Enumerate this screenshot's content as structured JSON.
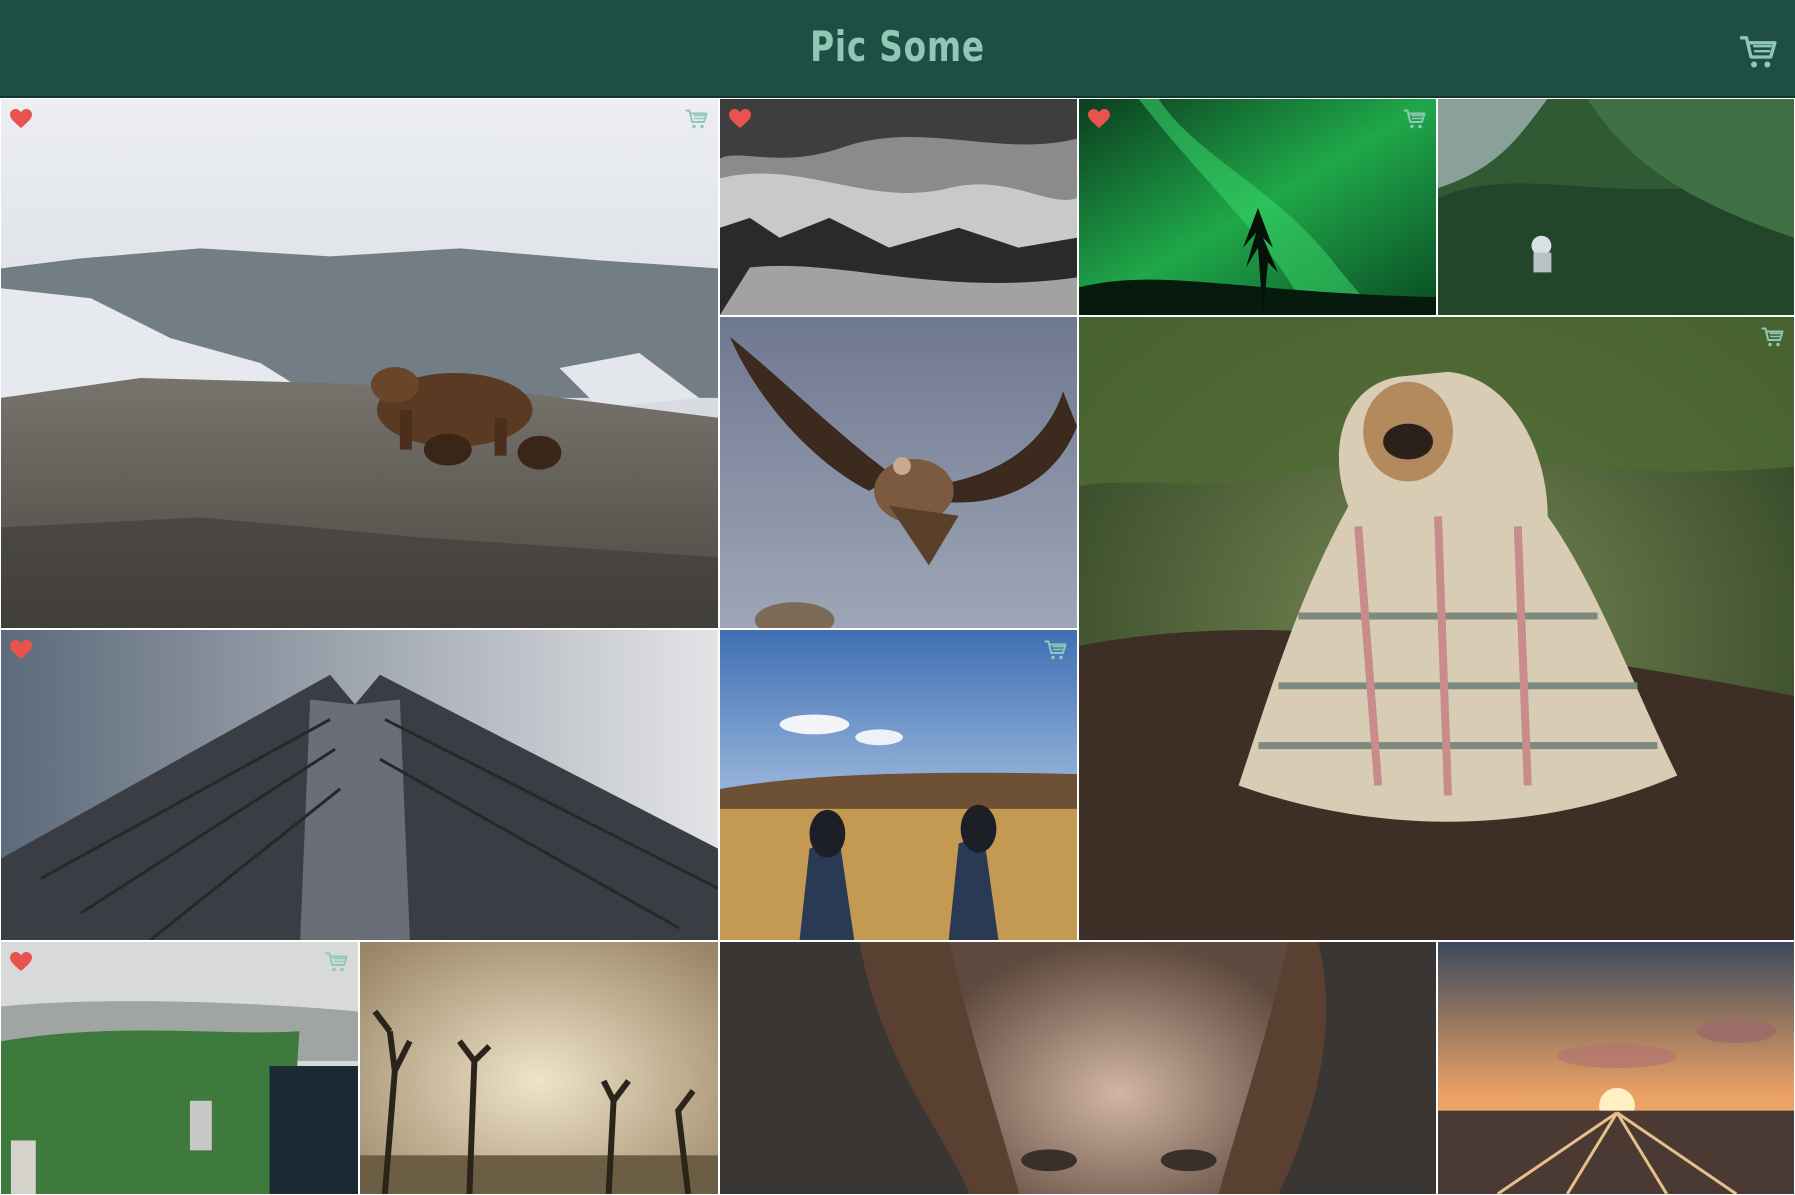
{
  "app": {
    "title": "Pic Some"
  },
  "header": {
    "cart_icon": "cart-icon"
  },
  "colors": {
    "header_bg": "#1f4e45",
    "title": "#8fc9b6",
    "heart": "#e8534f",
    "cart_icon": "#8fc9b6"
  },
  "tiles": [
    {
      "subject": "bear-with-cubs",
      "favorited": true,
      "in_cart": true
    },
    {
      "subject": "misty-forest-bw",
      "favorited": true,
      "in_cart": false
    },
    {
      "subject": "northern-lights",
      "favorited": true,
      "in_cart": true
    },
    {
      "subject": "mountain-biker-forest",
      "favorited": false,
      "in_cart": false
    },
    {
      "subject": "vulture-flying",
      "favorited": false,
      "in_cart": false
    },
    {
      "subject": "pug-in-blanket",
      "favorited": false,
      "in_cart": true
    },
    {
      "subject": "skyscraper-from-below",
      "favorited": true,
      "in_cart": false
    },
    {
      "subject": "sneakers-on-grass",
      "favorited": false,
      "in_cart": true
    },
    {
      "subject": "central-park-aerial",
      "favorited": true,
      "in_cart": true
    },
    {
      "subject": "dead-trees-fog",
      "favorited": false,
      "in_cart": false
    },
    {
      "subject": "woman-face-closeup",
      "favorited": false,
      "in_cart": false
    },
    {
      "subject": "sunset-rail-yard",
      "favorited": false,
      "in_cart": false
    }
  ]
}
